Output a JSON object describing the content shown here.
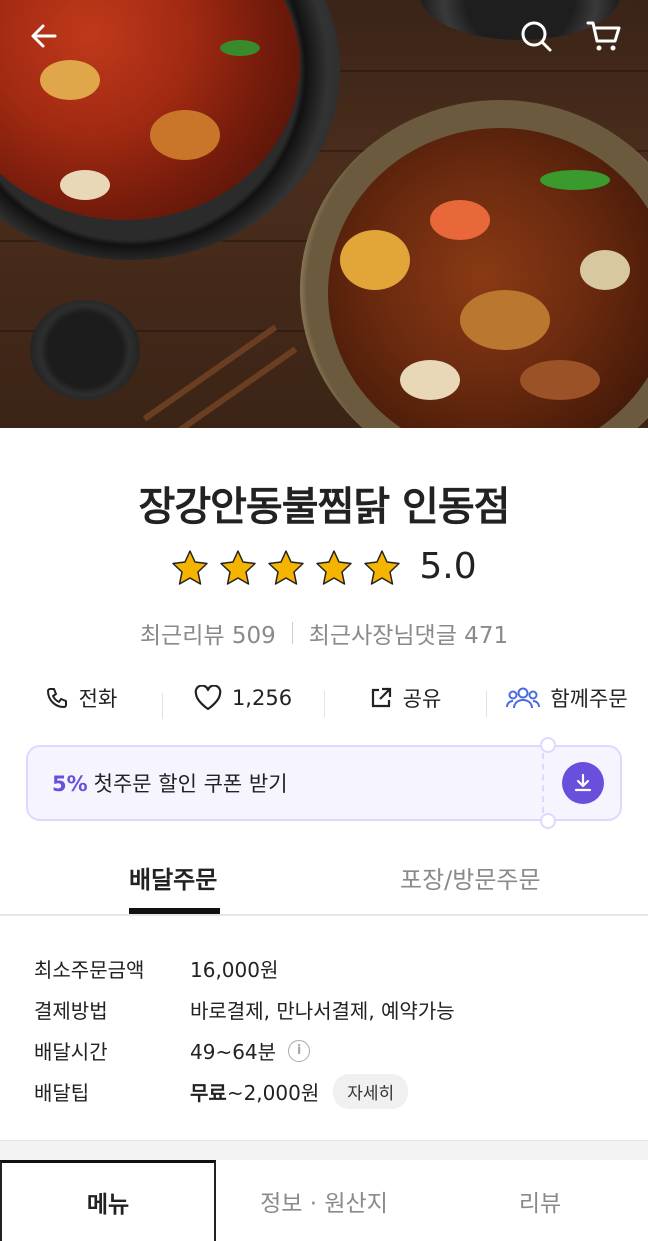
{
  "header": {
    "back_icon": "back-arrow-icon",
    "search_icon": "search-icon",
    "cart_icon": "cart-icon"
  },
  "store": {
    "name": "장강안동불찜닭 인동점",
    "rating": "5.0",
    "stars_filled": 5,
    "stars_total": 5,
    "recent_reviews_label": "최근리뷰 509",
    "owner_replies_label": "최근사장님댓글 471"
  },
  "actions": [
    {
      "icon": "phone-icon",
      "label": "전화"
    },
    {
      "icon": "heart-icon",
      "label": "1,256"
    },
    {
      "icon": "share-icon",
      "label": "공유"
    },
    {
      "icon": "group-icon",
      "label": "함께주문"
    }
  ],
  "coupon": {
    "percent": "5%",
    "text": "첫주문 할인 쿠폰 받기",
    "icon": "download-icon"
  },
  "order_tabs": {
    "delivery": "배달주문",
    "pickup": "포장/방문주문"
  },
  "info": {
    "min_order_label": "최소주문금액",
    "min_order_value": "16,000원",
    "payment_label": "결제방법",
    "payment_value": "바로결제, 만나서결제, 예약가능",
    "delivery_time_label": "배달시간",
    "delivery_time_value": "49~64분",
    "delivery_tip_label": "배달팁",
    "delivery_tip_free": "무료",
    "delivery_tip_value": "~2,000원",
    "detail_label": "자세히"
  },
  "bottom_tabs": {
    "menu": "메뉴",
    "info_origin": "정보 · 원산지",
    "review": "리뷰"
  },
  "colors": {
    "accent": "#6a4fdc",
    "star": "#f5b400"
  }
}
